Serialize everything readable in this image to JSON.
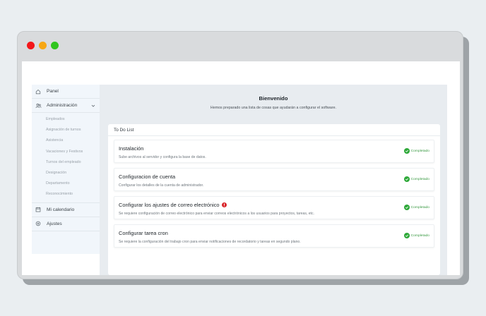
{
  "colors": {
    "red": "#f3171a",
    "yellow": "#f7a714",
    "green": "#30c51f",
    "status_green": "#2fa93a",
    "warning_red": "#d8252a"
  },
  "sidebar": {
    "items": [
      {
        "label": "Panel",
        "icon": "home-icon"
      },
      {
        "label": "Administración",
        "icon": "users-icon",
        "expanded": true,
        "children": [
          "Empleados",
          "Asignación de turnos",
          "Asistencia",
          "Vacaciones y Festivos",
          "Turnos del empleado",
          "Designación",
          "Departamento",
          "Reconocimiento"
        ]
      },
      {
        "label": "Mi calendario",
        "icon": "calendar-icon"
      },
      {
        "label": "Ajustes",
        "icon": "settings-icon"
      }
    ]
  },
  "main": {
    "title": "Bienvenido",
    "subtitle": "Hemos preparado una lista de cosas que ayudarán a configurar el software."
  },
  "todo": {
    "header": "To Do List",
    "tasks": [
      {
        "title": "Instalación",
        "description": "Sube archivos al servidor y configura la base de datos.",
        "status": "Completado",
        "warning": false
      },
      {
        "title": "Configuracion de cuenta",
        "description": "Configurar los detalles de la cuenta de administrador.",
        "status": "Completado",
        "warning": false
      },
      {
        "title": "Configurar los ajustes de correo electrónico",
        "description": "Se requiere configuración de correo electrónico para enviar correos electrónicos a los usuarios para proyectos, tareas, etc.",
        "status": "Completado",
        "warning": true
      },
      {
        "title": "Configurar tarea cron",
        "description": "Se requiere la configuración del trabajo cron para enviar notificaciones de recordatorio y tareas en segundo plano.",
        "status": "Completado",
        "warning": false
      }
    ]
  }
}
